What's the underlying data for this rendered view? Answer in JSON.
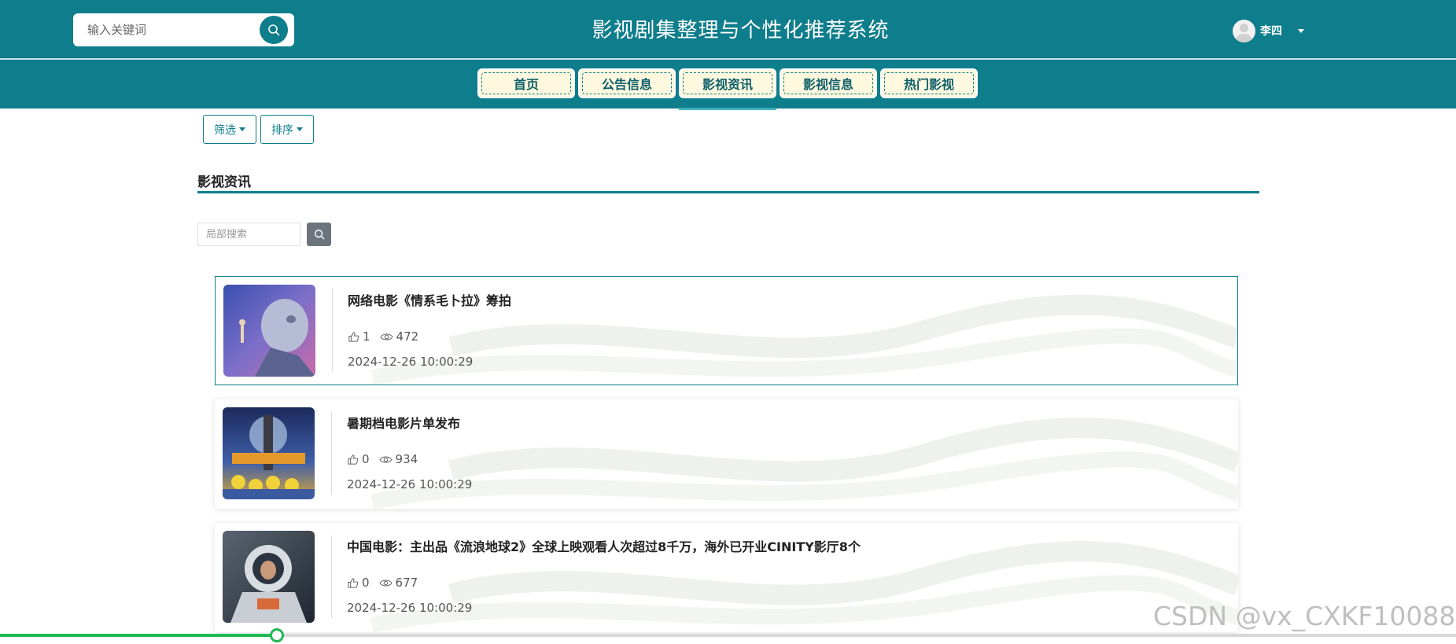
{
  "header": {
    "search_placeholder": "输入关键词",
    "title": "影视剧集整理与个性化推荐系统",
    "user_name": "李四"
  },
  "nav": {
    "items": [
      {
        "label": "首页",
        "active": false
      },
      {
        "label": "公告信息",
        "active": false
      },
      {
        "label": "影视资讯",
        "active": true
      },
      {
        "label": "影视信息",
        "active": false
      },
      {
        "label": "热门影视",
        "active": false
      }
    ]
  },
  "toolbar": {
    "filter_label": "筛选",
    "sort_label": "排序"
  },
  "section": {
    "title": "影视资讯",
    "local_search_placeholder": "局部搜索"
  },
  "news": [
    {
      "title": "网络电影《情系毛卜拉》筹拍",
      "likes": "1",
      "views": "472",
      "time": "2024-12-26 10:00:29",
      "selected": true
    },
    {
      "title": "暑期档电影片单发布",
      "likes": "0",
      "views": "934",
      "time": "2024-12-26 10:00:29",
      "selected": false
    },
    {
      "title": "中国电影：主出品《流浪地球2》全球上映观看人次超过8千万，海外已开业CINITY影厅8个",
      "likes": "0",
      "views": "677",
      "time": "2024-12-26 10:00:29",
      "selected": false
    }
  ],
  "watermark": "CSDN @vx_CXKF10088",
  "colors": {
    "primary": "#0e7d8c",
    "nav_bg": "#fdf8de",
    "progress": "#1db954"
  },
  "video_progress": 0.19
}
